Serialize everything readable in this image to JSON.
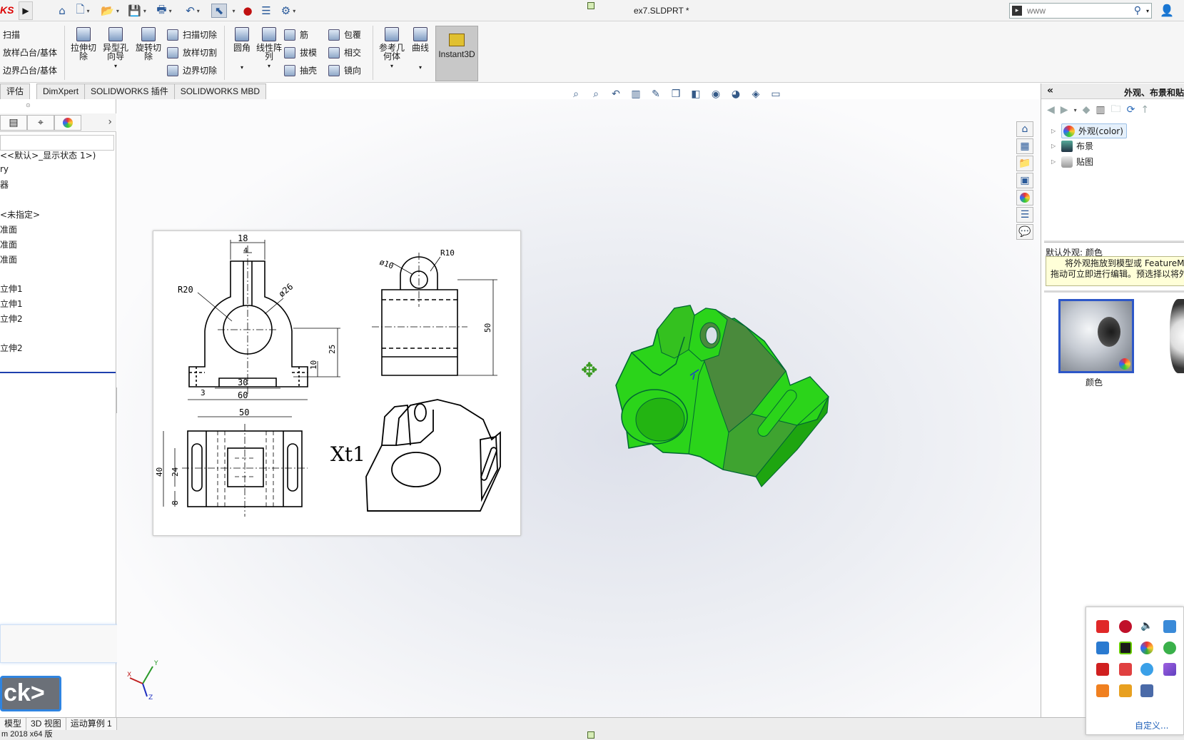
{
  "app": {
    "logo": "KS",
    "document_title": "ex7.SLDPRT *"
  },
  "search": {
    "placeholder": "www"
  },
  "ribbon": {
    "extrude_group": [
      "扫描",
      "放样凸台/基体",
      "边界凸台/基体"
    ],
    "extruded_cut": "拉伸切\n除",
    "hole_wizard": "异型孔\n向导",
    "revolved_cut": "旋转切\n除",
    "cut_group": [
      "扫描切除",
      "放样切割",
      "边界切除"
    ],
    "fillet": "圆角",
    "linear_pattern": "线性阵\n列",
    "feature_group1": [
      "筋",
      "拔模",
      "抽壳"
    ],
    "feature_group2": [
      "包覆",
      "相交",
      "镜向"
    ],
    "ref_geometry": "参考几\n何体",
    "curves": "曲线",
    "instant3d": "Instant3D"
  },
  "tabs": [
    "评估",
    "DimXpert",
    "SOLIDWORKS 插件",
    "SOLIDWORKS MBD"
  ],
  "feature_tree": [
    "<<默认>_显示状态 1>)",
    "ry",
    "器",
    "<未指定>",
    "准面",
    "准面",
    "准面",
    "立伸1",
    "立伸1",
    "立伸2",
    "立伸2"
  ],
  "back_button": "ck>",
  "bottom_tabs": [
    "模型",
    "3D 视图",
    "运动算例 1"
  ],
  "status": {
    "version": "m 2018 x64 版"
  },
  "drawing": {
    "dims": {
      "d18": "18",
      "d4": "4",
      "r20": "R20",
      "dia26": "ø26",
      "d25": "25",
      "d10": "10",
      "d3": "3",
      "d30": "30",
      "d60": "60",
      "dia10": "ø10",
      "r10": "R10",
      "d50": "50",
      "d50b": "50",
      "d40": "40",
      "d24": "24",
      "d8": "8"
    },
    "label": "Xt1"
  },
  "task_pane": {
    "title": "外观、布景和贴",
    "tree": [
      "外观(color)",
      "布景",
      "贴图"
    ],
    "default_appearance": "默认外观: 颜色",
    "tip_line1": "将外观拖放到模型或 FeatureM",
    "tip_line2": "拖动可立即进行编辑。预选择以将外",
    "swatch_label": "颜色"
  },
  "tray": {
    "customize": "自定义..."
  },
  "colors": {
    "model_green": "#22c80f",
    "selection_blue": "#2d57c8",
    "tip_yellow": "#ffffd8"
  }
}
